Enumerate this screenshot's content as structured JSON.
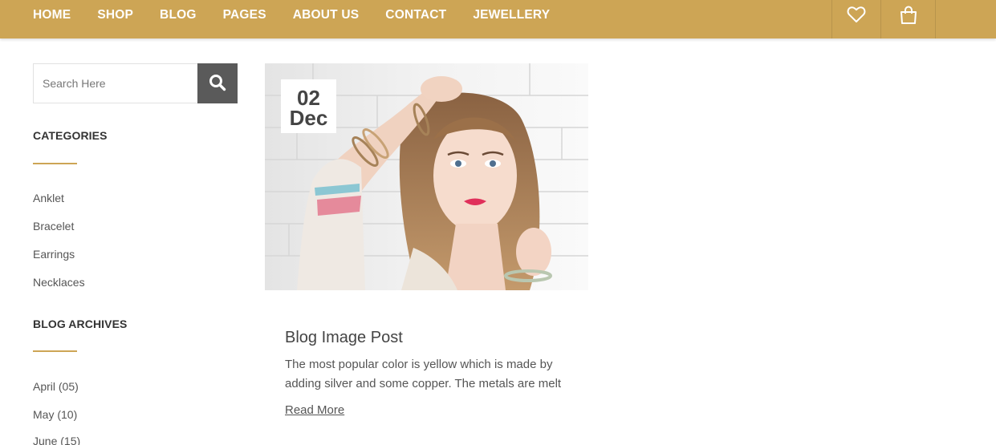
{
  "nav": {
    "items": [
      "HOME",
      "SHOP",
      "BLOG",
      "PAGES",
      "ABOUT US",
      "CONTACT",
      "JEWELLERY"
    ],
    "icons": [
      "heart-icon",
      "shopping-bag-icon"
    ]
  },
  "sidebar": {
    "search": {
      "placeholder": "Search Here",
      "icon": "search-icon"
    },
    "categories": {
      "title": "CATEGORIES",
      "items": [
        "Anklet",
        "Bracelet",
        "Earrings",
        "Necklaces"
      ]
    },
    "archives": {
      "title": "BLOG ARCHIVES",
      "items": [
        "April (05)",
        "May (10)",
        "June (15)"
      ]
    }
  },
  "post": {
    "date_day": "02",
    "date_month": "Dec",
    "title": "Blog Image Post",
    "excerpt": "The most popular color is yellow which is made by adding silver and some copper. The metals are melt",
    "read_more": "Read More"
  },
  "colors": {
    "accent": "#cda555",
    "search_button": "#5a5a5a",
    "text": "#444444"
  }
}
